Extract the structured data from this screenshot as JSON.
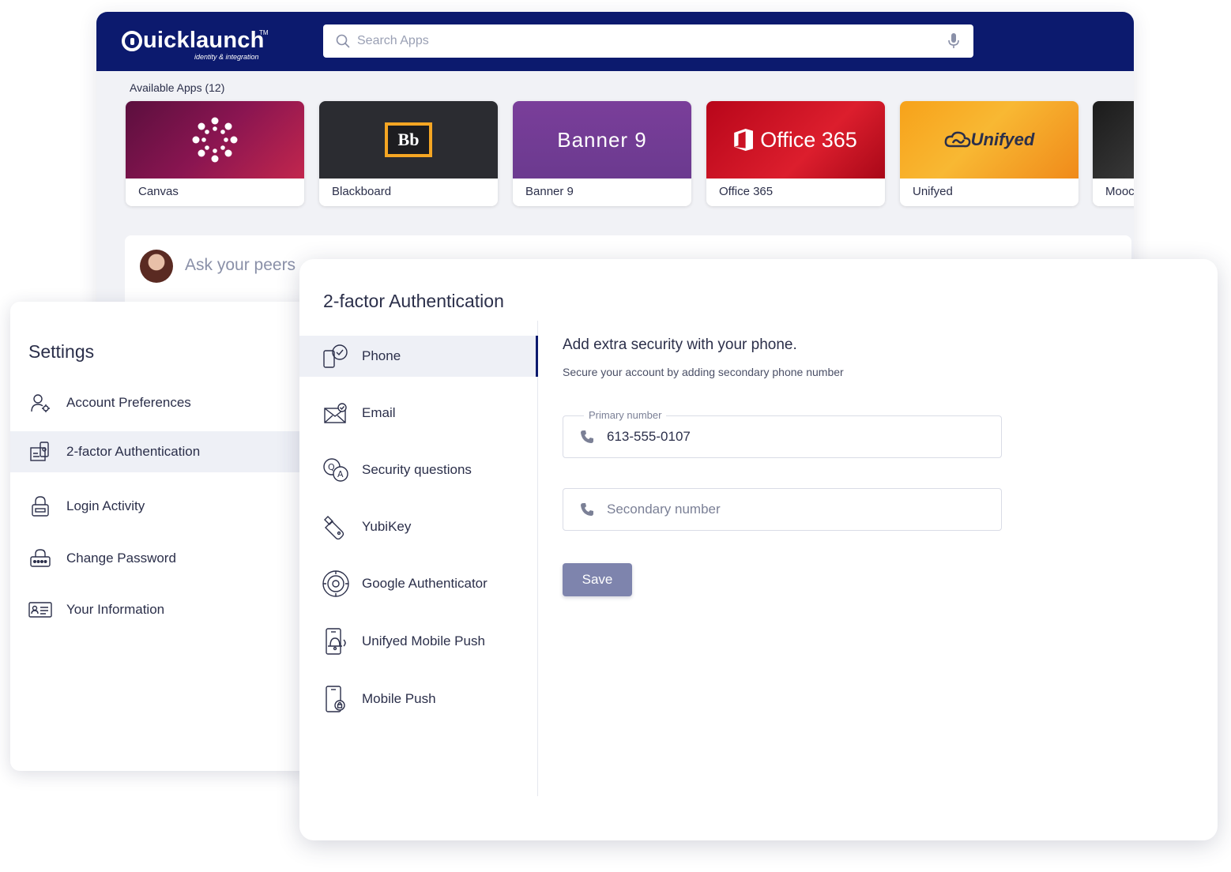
{
  "portal": {
    "logo": "uicklaunch",
    "logo_tm": "TM",
    "logo_tagline": "identity & integration",
    "search_placeholder": "Search Apps",
    "apps_title": "Available Apps (12)",
    "apps": [
      {
        "name": "Canvas"
      },
      {
        "name": "Blackboard",
        "logo_text": "Bb"
      },
      {
        "name": "Banner 9",
        "logo_text": "Banner 9"
      },
      {
        "name": "Office 365",
        "logo_text": "Office 365"
      },
      {
        "name": "Unifyed",
        "logo_text": "Unifyed"
      },
      {
        "name": "Mooc"
      }
    ],
    "peers_placeholder": "Ask your peers"
  },
  "settings": {
    "title": "Settings",
    "items": [
      {
        "label": "Account Preferences",
        "icon": "user-gear-icon"
      },
      {
        "label": "2-factor Authentication",
        "icon": "two-factor-icon",
        "active": true
      },
      {
        "label": "Login Activity",
        "icon": "lock-icon"
      },
      {
        "label": "Change Password",
        "icon": "password-lock-icon"
      },
      {
        "label": "Your Information",
        "icon": "id-card-icon"
      }
    ]
  },
  "two_factor": {
    "title": "2-factor Authentication",
    "methods": [
      {
        "label": "Phone",
        "icon": "phone-check-icon",
        "active": true
      },
      {
        "label": "Email",
        "icon": "email-check-icon"
      },
      {
        "label": "Security questions",
        "icon": "qa-icon"
      },
      {
        "label": "YubiKey",
        "icon": "usb-key-icon"
      },
      {
        "label": "Google Authenticator",
        "icon": "authenticator-icon"
      },
      {
        "label": "Unifyed Mobile Push",
        "icon": "mobile-bell-icon"
      },
      {
        "label": "Mobile Push",
        "icon": "mobile-lock-icon"
      }
    ],
    "pane_title": "Add extra security with your phone.",
    "pane_subtitle": "Secure your account by adding secondary phone number",
    "primary_label": "Primary number",
    "primary_value": "613-555-0107",
    "secondary_placeholder": "Secondary number",
    "save_label": "Save"
  },
  "colors": {
    "header": "#0c1a6e",
    "accent": "#0c1a6e",
    "save_button": "#7e84ad"
  }
}
